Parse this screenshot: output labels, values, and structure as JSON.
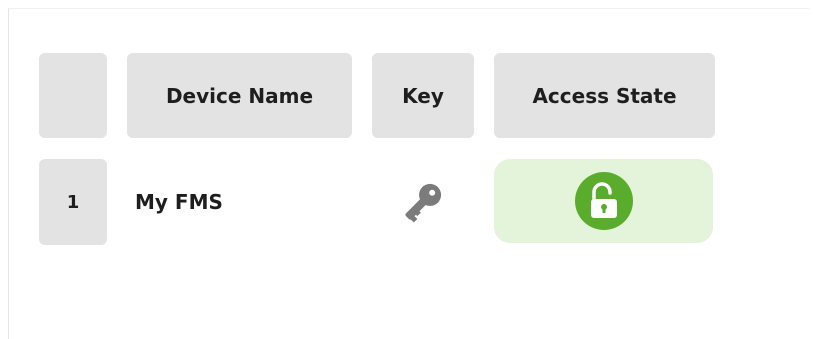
{
  "table": {
    "headers": {
      "index": "",
      "device_name": "Device Name",
      "key": "Key",
      "access_state": "Access State"
    },
    "rows": [
      {
        "index": "1",
        "device_name": "My FMS",
        "key_icon": "key-icon",
        "access_state_icon": "unlocked-padlock-icon"
      }
    ]
  },
  "colors": {
    "header_bg": "#e3e3e3",
    "access_state_bg": "#e3f4da",
    "unlocked_green": "#5aad2c",
    "key_icon_gray": "#7b7b7b"
  }
}
